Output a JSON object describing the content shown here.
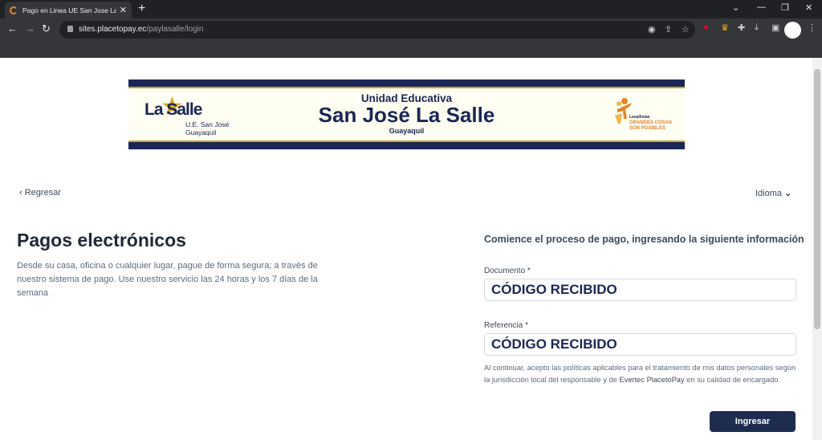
{
  "browser": {
    "tab_title": "Pago en Linea UE San Jose La Sal",
    "tab_close": "✕",
    "new_tab": "+",
    "url_domain": "sites.placetopay.ec",
    "url_path": "/paylasalle/login"
  },
  "banner": {
    "logo_text": "La Salle",
    "logo_sub1": "U.E. San José",
    "logo_sub2": "Guayaquil",
    "line1": "Unidad Educativa",
    "line2": "San José La Salle",
    "line3": "Guayaquil",
    "slogan_small": "Lasallistas",
    "slogan_big1": "GRANDES COSAS",
    "slogan_big2": "SON POSIBLES"
  },
  "nav": {
    "back_label": "Regresar",
    "language_label": "Idioma"
  },
  "main": {
    "title": "Pagos electrónicos",
    "description": "Desde su casa, oficina o cualquier lugar, pague de forma segura; a través de nuestro sistema de pago. Use nuestro servicio las 24 horas y los 7 días de la semana"
  },
  "form": {
    "intro": "Comience el proceso de pago, ingresando la siguiente información",
    "document_label": "Documento *",
    "document_value": "CÓDIGO RECIBIDO",
    "reference_label": "Referencia *",
    "reference_value": "CÓDIGO RECIBIDO",
    "legal_pre": "Al continuar, acepto las políticas aplicables para el tratamiento de mis datos personales según la jurisdicción local del responsable y de ",
    "legal_brand": "Evertec PlacetoPay",
    "legal_post": " en su calidad de encargado.",
    "submit_label": "Ingresar"
  },
  "colors": {
    "navy": "#1a2656",
    "button": "#1d2c4f",
    "gold": "#c9a227",
    "orange": "#e2852b"
  }
}
